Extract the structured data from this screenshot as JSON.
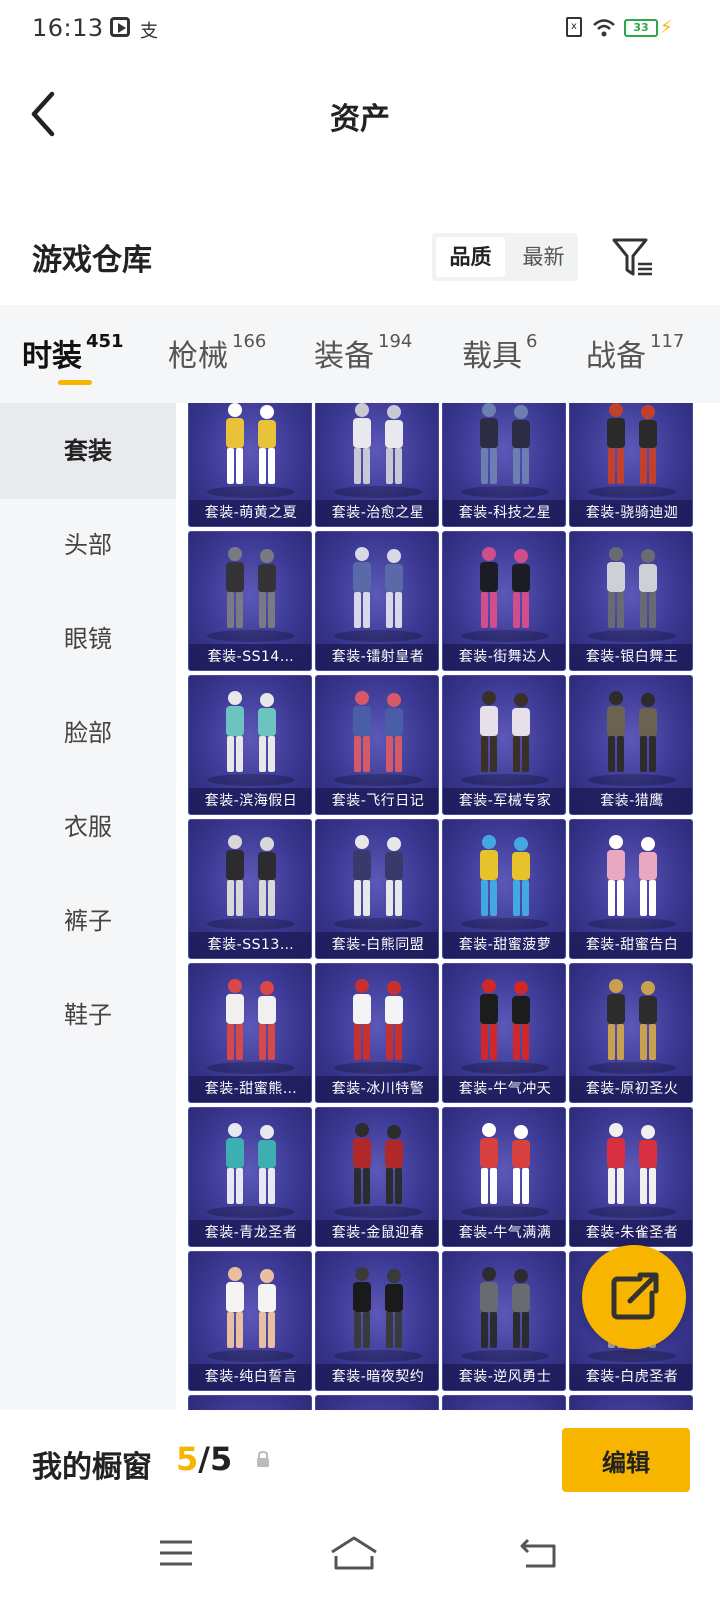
{
  "status_bar": {
    "time": "16:13",
    "alipay": "支",
    "sim": "x",
    "battery": "33"
  },
  "header": {
    "title": "资产"
  },
  "section": {
    "title": "游戏仓库",
    "sort_options": [
      "品质",
      "最新"
    ]
  },
  "tabs": [
    {
      "label": "时装",
      "count": "451"
    },
    {
      "label": "枪械",
      "count": "166"
    },
    {
      "label": "装备",
      "count": "194"
    },
    {
      "label": "载具",
      "count": "6"
    },
    {
      "label": "战备",
      "count": "117"
    }
  ],
  "categories": [
    "套装",
    "头部",
    "眼镜",
    "脸部",
    "衣服",
    "裤子",
    "鞋子"
  ],
  "items": [
    "套装-萌黄之夏",
    "套装-治愈之星",
    "套装-科技之星",
    "套装-骁骑迪迦",
    "套装-SS14…",
    "套装-镭射皇者",
    "套装-街舞达人",
    "套装-银白舞王",
    "套装-滨海假日",
    "套装-飞行日记",
    "套装-军械专家",
    "套装-猎鹰",
    "套装-SS13…",
    "套装-白熊同盟",
    "套装-甜蜜菠萝",
    "套装-甜蜜告白",
    "套装-甜蜜熊…",
    "套装-冰川特警",
    "套装-牛气冲天",
    "套装-原初圣火",
    "套装-青龙圣者",
    "套装-金鼠迎春",
    "套装-牛气满满",
    "套装-朱雀圣者",
    "套装-纯白誓言",
    "套装-暗夜契约",
    "套装-逆风勇士",
    "套装-白虎圣者"
  ],
  "showcase": {
    "label": "我的橱窗",
    "current": "5",
    "total": "/5",
    "edit_label": "编辑"
  },
  "colors": {
    "accent": "#f7b500",
    "card_bg": "#3a3892"
  }
}
